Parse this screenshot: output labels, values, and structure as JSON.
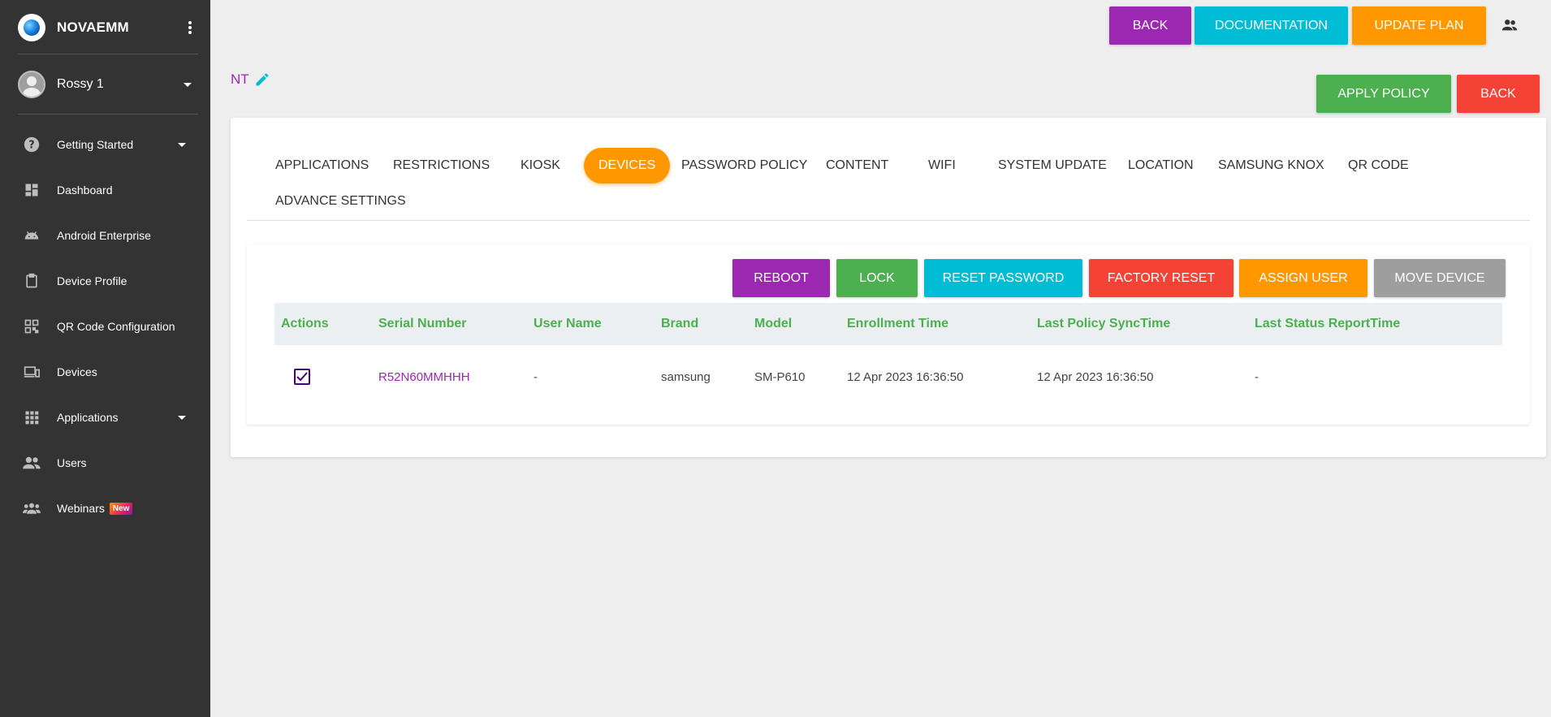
{
  "sidebar": {
    "brand": "NOVAEMM",
    "user": "Rossy 1",
    "items": [
      {
        "label": "Getting Started",
        "icon": "help-icon"
      },
      {
        "label": "Dashboard",
        "icon": "dashboard-icon"
      },
      {
        "label": "Android Enterprise",
        "icon": "android-icon"
      },
      {
        "label": "Device Profile",
        "icon": "clipboard-icon"
      },
      {
        "label": "QR Code Configuration",
        "icon": "qr-code-icon"
      },
      {
        "label": "Devices",
        "icon": "devices-icon"
      },
      {
        "label": "Applications",
        "icon": "apps-grid-icon"
      },
      {
        "label": "Users",
        "icon": "users-icon"
      },
      {
        "label": "Webinars",
        "icon": "webinars-icon",
        "badge": "New"
      }
    ]
  },
  "header": {
    "back": "BACK",
    "documentation": "DOCUMENTATION",
    "update_plan": "UPDATE PLAN"
  },
  "policy": {
    "name": "NT",
    "apply": "APPLY POLICY",
    "back": "BACK"
  },
  "tabs": {
    "applications": "APPLICATIONS",
    "restrictions": "RESTRICTIONS",
    "kiosk": "KIOSK",
    "devices": "DEVICES",
    "password_policy": "PASSWORD POLICY",
    "content": "CONTENT",
    "wifi": "WIFI",
    "system_update": "SYSTEM UPDATE",
    "location": "LOCATION",
    "samsung_knox": "SAMSUNG KNOX",
    "qr_code": "QR CODE",
    "advance_settings": "ADVANCE SETTINGS",
    "active": "DEVICES"
  },
  "actions": {
    "reboot": "REBOOT",
    "lock": "LOCK",
    "reset_password": "RESET PASSWORD",
    "factory_reset": "FACTORY RESET",
    "assign_user": "ASSIGN USER",
    "move_device": "MOVE DEVICE"
  },
  "table": {
    "columns": [
      "Actions",
      "Serial Number",
      "User Name",
      "Brand",
      "Model",
      "Enrollment Time",
      "Last Policy SyncTime",
      "Last Status ReportTime"
    ],
    "rows": [
      {
        "checked": true,
        "serial": "R52N60MMHHH",
        "user": "-",
        "brand": "samsung",
        "model": "SM-P610",
        "enrollment": "12 Apr 2023 16:36:50",
        "last_sync": "12 Apr 2023 16:36:50",
        "last_status": "-"
      }
    ]
  },
  "colors": {
    "purple": "#9c27b0",
    "cyan": "#00bcd4",
    "orange": "#ff9800",
    "green": "#4caf50",
    "red": "#f44336",
    "grey": "#9e9e9e",
    "sidebar": "#333333"
  }
}
